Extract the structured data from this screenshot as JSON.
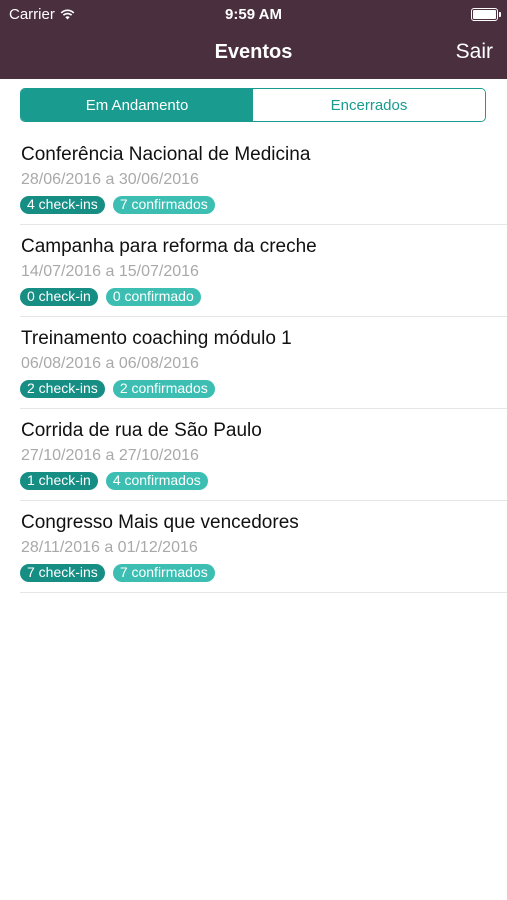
{
  "status_bar": {
    "carrier": "Carrier",
    "time": "9:59 AM",
    "battery_level": 1.0
  },
  "nav": {
    "title": "Eventos",
    "logout_label": "Sair"
  },
  "tabs": [
    {
      "label": "Em Andamento",
      "selected": true
    },
    {
      "label": "Encerrados",
      "selected": false
    }
  ],
  "events": [
    {
      "name": "Conferência Nacional de Medicina",
      "dates": "28/06/2016 a 30/06/2016",
      "checkins": "4 check-ins",
      "confirmed": "7 confirmados"
    },
    {
      "name": "Campanha para reforma da creche",
      "dates": "14/07/2016 a 15/07/2016",
      "checkins": "0 check-in",
      "confirmed": "0 confirmado"
    },
    {
      "name": "Treinamento coaching módulo 1",
      "dates": "06/08/2016 a 06/08/2016",
      "checkins": "2 check-ins",
      "confirmed": "2 confirmados"
    },
    {
      "name": "Corrida de rua de São Paulo",
      "dates": "27/10/2016 a 27/10/2016",
      "checkins": "1 check-in",
      "confirmed": "4 confirmados"
    },
    {
      "name": "Congresso Mais que vencedores",
      "dates": "28/11/2016 a 01/12/2016",
      "checkins": "7 check-ins",
      "confirmed": "7 confirmados"
    }
  ],
  "colors": {
    "header_bg": "#4a2f3e",
    "accent": "#1a9b8f",
    "checkin_badge": "#178e84",
    "confirmed_badge": "#3cbfb2",
    "date_text": "#a9a9a9"
  },
  "icons": {
    "wifi": "wifi-icon",
    "battery": "battery-icon"
  }
}
